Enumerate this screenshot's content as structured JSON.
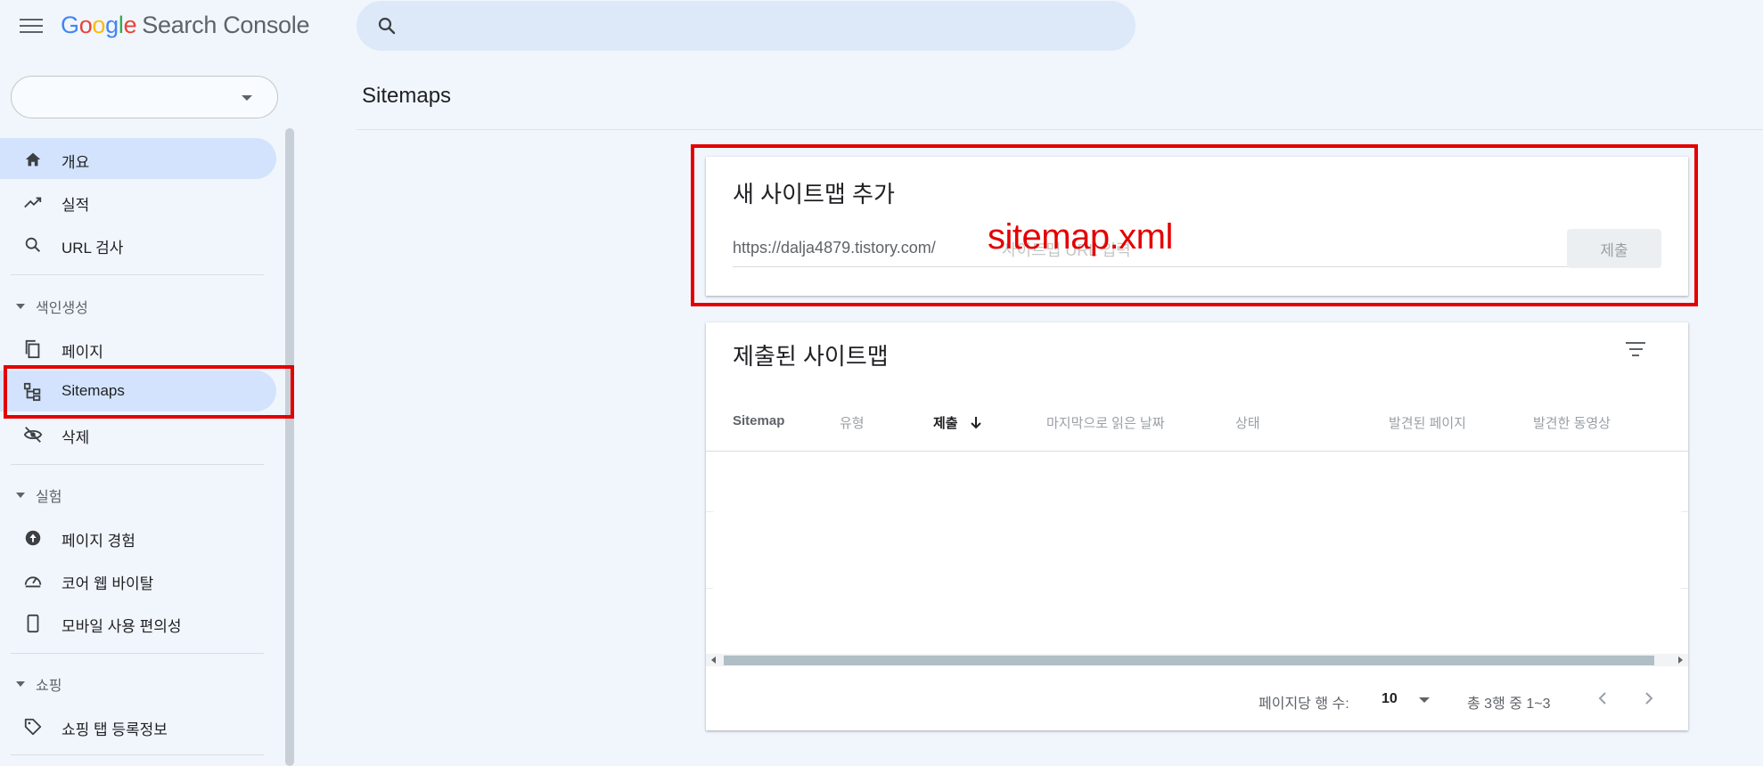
{
  "app": {
    "logo_letters": [
      "G",
      "o",
      "o",
      "g",
      "l",
      "e"
    ],
    "product": "Search Console"
  },
  "sidebar": {
    "property_value": "",
    "items": [
      {
        "label": "개요",
        "icon": "home-icon"
      },
      {
        "label": "실적",
        "icon": "trending-up-icon"
      },
      {
        "label": "URL 검사",
        "icon": "search-icon"
      },
      {
        "label": "페이지",
        "icon": "pages-icon"
      },
      {
        "label": "Sitemaps",
        "icon": "sitemap-icon"
      },
      {
        "label": "삭제",
        "icon": "eye-off-icon"
      },
      {
        "label": "페이지 경험",
        "icon": "plus-circle-icon"
      },
      {
        "label": "코어 웹 바이탈",
        "icon": "gauge-icon"
      },
      {
        "label": "모바일 사용 편의성",
        "icon": "phone-icon"
      },
      {
        "label": "쇼핑 탭 등록정보",
        "icon": "tag-icon"
      }
    ],
    "sections": {
      "indexing": "색인생성",
      "experience": "실험",
      "shopping": "쇼핑"
    }
  },
  "main": {
    "page_title": "Sitemaps",
    "add_card": {
      "title": "새 사이트맵 추가",
      "url_prefix": "https://dalja4879.tistory.com/",
      "input_value": "",
      "input_placeholder": "사이트맵 URL 입력",
      "submit_label": "제출",
      "annotation": "sitemap.xml"
    },
    "list_card": {
      "title": "제출된 사이트맵",
      "columns": [
        "Sitemap",
        "유형",
        "제출",
        "마지막으로 읽은 날짜",
        "상태",
        "발견된 페이지",
        "발견한 동영상"
      ],
      "rows": [],
      "pager": {
        "rows_per_page_label": "페이지당 행 수:",
        "rows_per_page": "10",
        "range": "총 3행 중 1~3"
      }
    }
  },
  "colors": {
    "annotation_red": "#e30000",
    "active_nav": "#d3e3fd",
    "background": "#f1f6fd"
  }
}
